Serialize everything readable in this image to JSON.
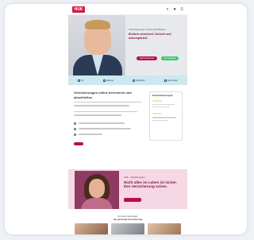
{
  "header": {
    "logo": "HUK",
    "icons": [
      "search-icon",
      "user-icon",
      "menu-icon"
    ]
  },
  "hero": {
    "eyebrow": "Versicherungen online abschließen",
    "title": "Einfach versichert. Schnell und unkompliziert.",
    "primary_cta": "Jetzt berechnen",
    "secondary_cta": "Zum Angebot"
  },
  "categories": [
    {
      "icon": "car-icon",
      "label": "Kfz"
    },
    {
      "icon": "home-icon",
      "label": "Hausrat"
    },
    {
      "icon": "shield-icon",
      "label": "Haftpflicht"
    },
    {
      "icon": "heart-icon",
      "label": "Gesundheit"
    }
  ],
  "content": {
    "title": "Versicherungen online berechnen und abschließen",
    "cta": "Mehr erfahren"
  },
  "side_box": {
    "title": "Kundenbewertungen",
    "stars_1": "★★★★★",
    "stars_2": "★★★★★"
  },
  "promo": {
    "eyebrow": "HUK – Versicherungen",
    "title": "Nicht alles im Leben ist sicher. Ihre Versicherung schon.",
    "cta": "Jetzt informieren"
  },
  "mid_section": {
    "line_1": "Für jede Lebenslage",
    "line_2": "die passende Versicherung"
  },
  "colors": {
    "brand": "#b3124a",
    "accent_green": "#3cc86b",
    "strip": "#cde8ee",
    "promo_bg": "#f6d7e4"
  }
}
